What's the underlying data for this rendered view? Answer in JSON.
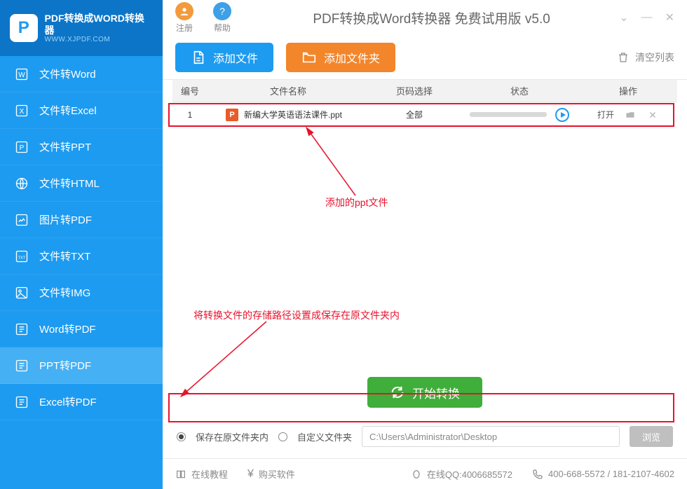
{
  "logo": {
    "title": "PDF转换成WORD转换器",
    "subtitle": "WWW.XJPDF.COM",
    "badge": "P"
  },
  "titlebar": {
    "register": "注册",
    "help": "帮助",
    "app_title": "PDF转换成Word转换器 免费试用版 v5.0"
  },
  "sidebar": {
    "items": [
      {
        "label": "文件转Word"
      },
      {
        "label": "文件转Excel"
      },
      {
        "label": "文件转PPT"
      },
      {
        "label": "文件转HTML"
      },
      {
        "label": "图片转PDF"
      },
      {
        "label": "文件转TXT"
      },
      {
        "label": "文件转IMG"
      },
      {
        "label": "Word转PDF"
      },
      {
        "label": "PPT转PDF"
      },
      {
        "label": "Excel转PDF"
      }
    ]
  },
  "toolbar": {
    "add_file": "添加文件",
    "add_folder": "添加文件夹",
    "clear_list": "清空列表"
  },
  "table": {
    "headers": {
      "num": "编号",
      "name": "文件名称",
      "page": "页码选择",
      "status": "状态",
      "op": "操作"
    },
    "rows": [
      {
        "num": "1",
        "name": "新编大学英语语法课件.ppt",
        "page": "全部",
        "open": "打开"
      }
    ]
  },
  "annotations": {
    "a1": "添加的ppt文件",
    "a2": "将转换文件的存储路径设置成保存在原文件夹内"
  },
  "convert": {
    "label": "开始转换"
  },
  "path": {
    "opt1": "保存在原文件夹内",
    "opt2": "自定义文件夹",
    "value": "C:\\Users\\Administrator\\Desktop",
    "browse": "浏览"
  },
  "footer": {
    "tutorial": "在线教程",
    "buy": "购买软件",
    "qq_label": "在线QQ:4006685572",
    "phone": "400-668-5572 / 181-2107-4602"
  }
}
